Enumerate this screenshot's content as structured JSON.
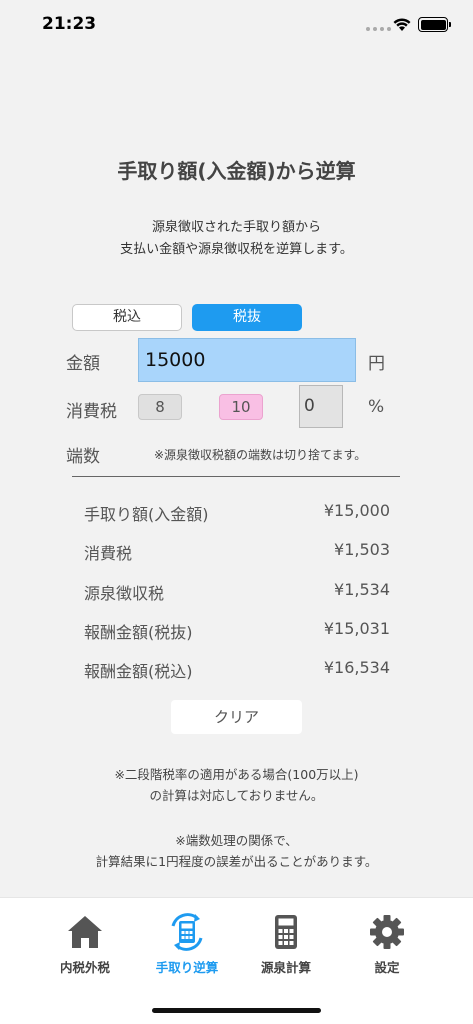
{
  "status": {
    "time": "21:23"
  },
  "header": {
    "title": "手取り額(入金額)から逆算"
  },
  "description": {
    "line1": "源泉徴収された手取り額から",
    "line2": "支払い金額や源泉徴収税を逆算します。"
  },
  "toggle": {
    "inclusive": "税込",
    "exclusive": "税抜",
    "selected": "税抜"
  },
  "form": {
    "amount_label": "金額",
    "amount_value": "15000",
    "yen_unit": "円",
    "tax_label": "消費税",
    "rate_8": "8",
    "rate_10": "10",
    "custom_rate": "0",
    "pct_unit": "%",
    "rounding_label": "端数",
    "rounding_note": "※源泉徴収税額の端数は切り捨てます。"
  },
  "results": [
    {
      "label": "手取り額(入金額)",
      "value": "¥15,000"
    },
    {
      "label": "消費税",
      "value": "¥1,503"
    },
    {
      "label": "源泉徴収税",
      "value": "¥1,534"
    },
    {
      "label": "報酬金額(税抜)",
      "value": "¥15,031"
    },
    {
      "label": "報酬金額(税込)",
      "value": "¥16,534"
    }
  ],
  "clear_label": "クリア",
  "notes": {
    "line1": "※二段階税率の適用がある場合(100万以上)",
    "line2": "の計算は対応しておりません。",
    "line3": "※端数処理の関係で、",
    "line4": "計算結果に1円程度の誤差が出ることがあります。"
  },
  "tabs": [
    {
      "label": "内税外税",
      "icon": "house-icon"
    },
    {
      "label": "手取り逆算",
      "icon": "calculator-refresh-icon",
      "active": true
    },
    {
      "label": "源泉計算",
      "icon": "calculator-icon"
    },
    {
      "label": "設定",
      "icon": "gear-icon"
    }
  ],
  "colors": {
    "accent": "#1e9bf0",
    "input_bg": "#a9d5fb",
    "rate10_bg": "#f9bfe4"
  }
}
